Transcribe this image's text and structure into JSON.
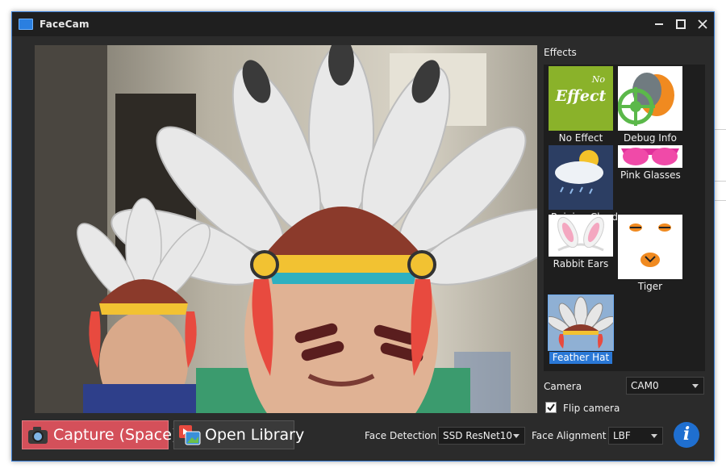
{
  "window": {
    "title": "FaceCam"
  },
  "effects": {
    "label": "Effects",
    "items": [
      {
        "label": "No Effect",
        "thumb_text_top": "No",
        "thumb_text": "Effect"
      },
      {
        "label": "Debug Info"
      },
      {
        "label": "Raining Cloud"
      },
      {
        "label": "Pink Glasses"
      },
      {
        "label": "Rabbit Ears"
      },
      {
        "label": "Tiger"
      },
      {
        "label": "Feather Hat",
        "selected": true
      }
    ]
  },
  "camera": {
    "label": "Camera",
    "value": "CAM0"
  },
  "flip": {
    "label": "Flip camera",
    "checked": true
  },
  "toolbar": {
    "capture_label": "Capture (Space)",
    "library_label": "Open Library",
    "face_detection_label": "Face Detection",
    "face_detection_value": "SSD ResNet10",
    "face_alignment_label": "Face Alignment",
    "face_alignment_value": "LBF",
    "info_glyph": "i"
  },
  "colors": {
    "accent": "#2a78d6",
    "capture": "#d4505a",
    "window_border": "#3b7fd6"
  }
}
